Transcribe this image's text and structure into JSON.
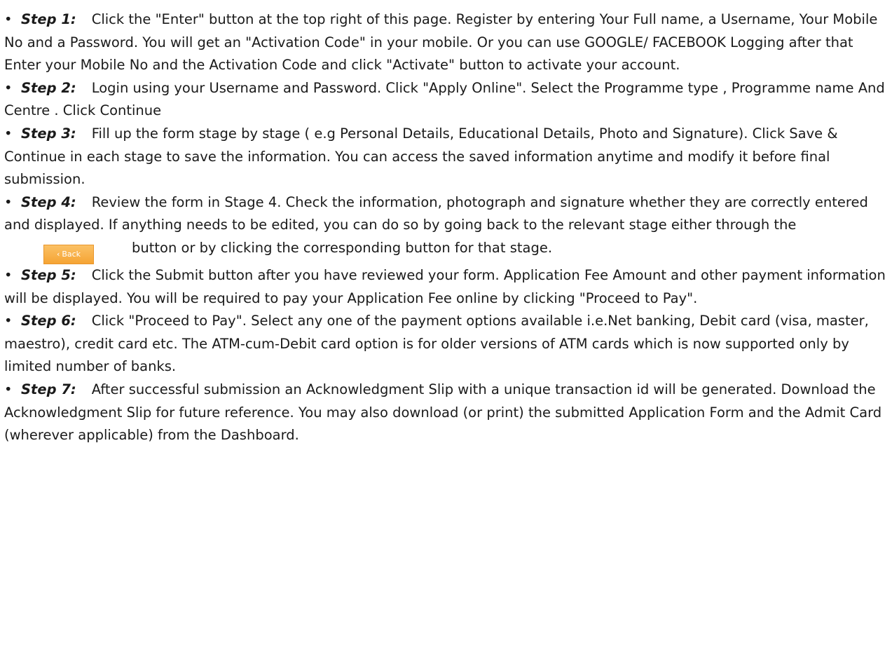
{
  "steps": [
    {
      "label": "Step 1:",
      "text": "Click the \"Enter\" button at the top right of this page. Register by entering Your Full name, a Username, Your Mobile No and a Password. You will get an \"Activation Code\" in your mobile. Or you can use GOOGLE/ FACEBOOK Logging after that Enter your Mobile No and the Activation Code and click \"Activate\" button to activate your account."
    },
    {
      "label": "Step 2:",
      "text": "Login using your Username and Password. Click \"Apply Online\". Select the Programme type , Programme name And Centre . Click Continue"
    },
    {
      "label": "Step 3:",
      "text": "Fill up the form stage by stage ( e.g Personal Details, Educational Details, Photo and Signature). Click Save & Continue in each stage to save the information. You can access the saved information anytime and modify it before final submission."
    },
    {
      "label": "Step 4:",
      "text_before": "Review the form in Stage 4. Check the information, photograph and signature whether they are correctly entered and displayed. If anything needs to be edited, you can do so by going back to the relevant stage either through the",
      "button_label": "Back",
      "text_after": "button or by clicking the corresponding button for that stage."
    },
    {
      "label": "Step 5:",
      "text": "Click the Submit button after you have reviewed your form. Application Fee Amount and other payment information will be displayed. You will be required to pay your Application Fee online by clicking \"Proceed to Pay\"."
    },
    {
      "label": "Step 6:",
      "text": "Click \"Proceed to Pay\". Select any one of the payment options available i.e.Net banking, Debit card (visa, master, maestro), credit card etc. The ATM-cum-Debit card option is for older versions of ATM cards which is now supported only by limited number of banks."
    },
    {
      "label": "Step 7:",
      "text": "After successful submission an Acknowledgment Slip with a unique transaction id will be generated. Download the Acknowledgment Slip for future reference. You may also download (or print) the submitted Application Form and the Admit Card (wherever applicable) from the Dashboard."
    }
  ],
  "bullet_glyph": "•",
  "back_icon": "chevron-left-icon",
  "colors": {
    "text": "#1a1a1a",
    "button_fill": "#f5a434",
    "button_text": "#ffffff"
  }
}
